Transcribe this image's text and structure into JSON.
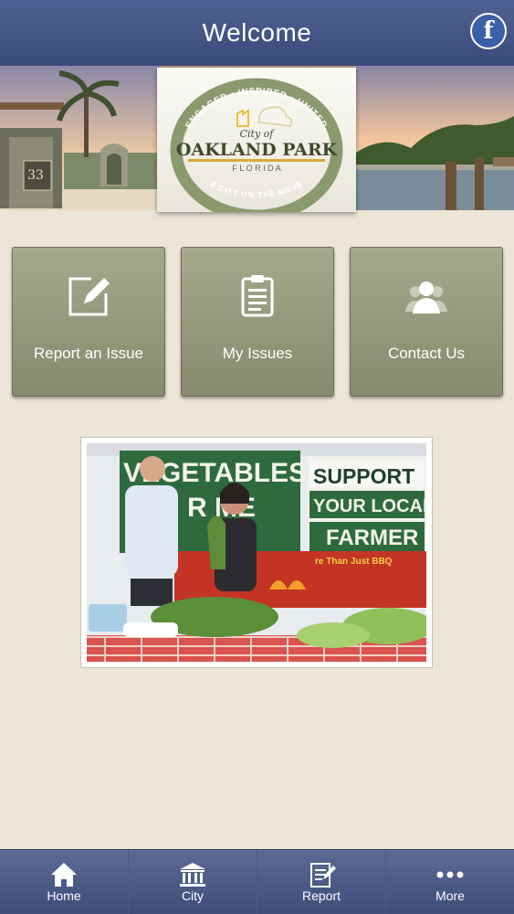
{
  "header": {
    "title": "Welcome",
    "social_icon": "facebook-icon",
    "social_glyph": "f"
  },
  "banner": {
    "seal": {
      "top_arc": "ENGAGED • INSPIRED • UNITED",
      "city_of": "City of",
      "name": "OAKLAND PARK",
      "state": "F L O R I D A",
      "motto": "A CITY ON THE MOVE"
    },
    "address_number": "33"
  },
  "tiles": [
    {
      "label": "Report an Issue",
      "icon": "pencil-edit-icon"
    },
    {
      "label": "My Issues",
      "icon": "clipboard-icon"
    },
    {
      "label": "Contact Us",
      "icon": "people-icon"
    }
  ],
  "photo": {
    "sign_left": "VEGETABLES",
    "sign_left2": "R  ME",
    "sign_right_1": "SUPPORT",
    "sign_right_2": "YOUR LOCAL",
    "sign_right_3": "FARMER",
    "van_text": "re Than Just BBQ"
  },
  "tabbar": [
    {
      "label": "Home",
      "icon": "home-icon"
    },
    {
      "label": "City",
      "icon": "city-hall-icon"
    },
    {
      "label": "Report",
      "icon": "report-icon"
    },
    {
      "label": "More",
      "icon": "more-dots-icon"
    }
  ],
  "colors": {
    "header": "#43527f",
    "tile": "#999d80",
    "background": "#ede5d8"
  }
}
